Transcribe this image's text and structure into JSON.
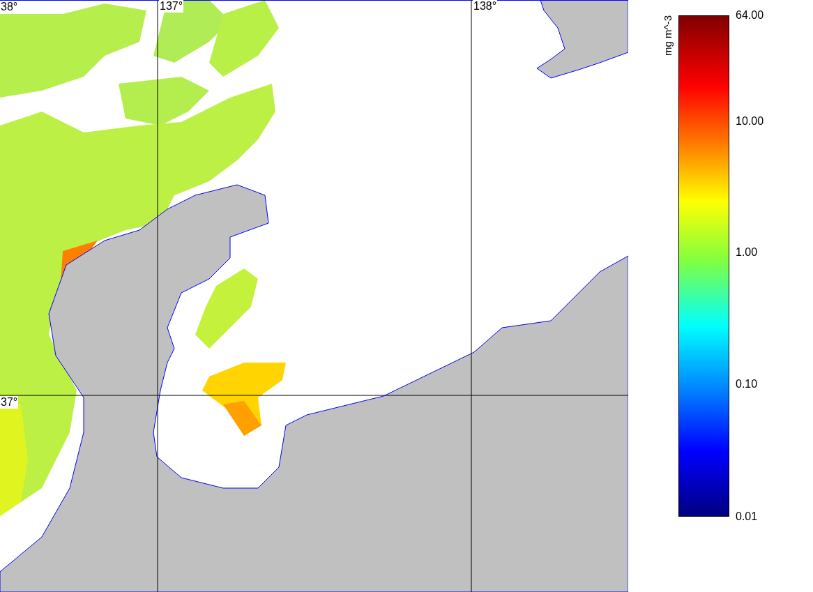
{
  "map": {
    "longitude_labels": [
      "137°",
      "138°"
    ],
    "latitude_labels": [
      "38°",
      "37°"
    ]
  },
  "colorbar": {
    "unit": "mg m^-3",
    "ticks": [
      "64.00",
      "10.00",
      "1.00",
      "0.10",
      "0.01"
    ]
  }
}
